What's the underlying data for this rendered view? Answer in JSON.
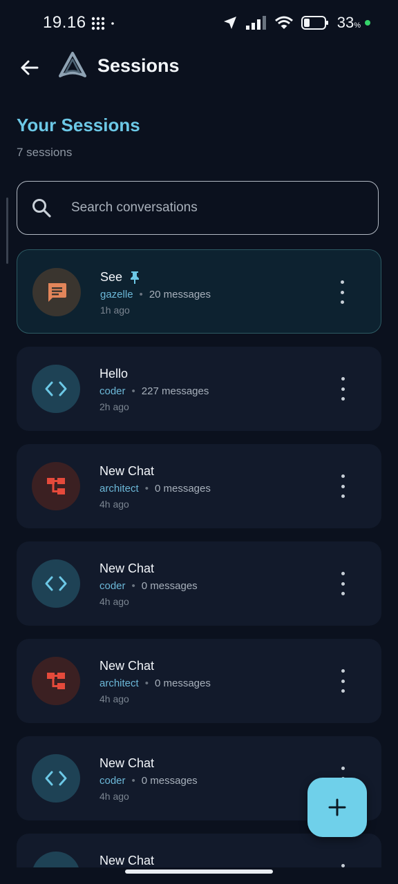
{
  "status_bar": {
    "time": "19.16",
    "battery_percent": "33",
    "battery_unit": "%"
  },
  "header": {
    "title": "Sessions"
  },
  "section": {
    "title": "Your Sessions",
    "count": "7 sessions"
  },
  "search": {
    "placeholder": "Search conversations",
    "value": ""
  },
  "sessions": [
    {
      "title": "See",
      "pinned": true,
      "agent": "gazelle",
      "messages": "20 messages",
      "time": "1h ago",
      "icon": "chat-icon"
    },
    {
      "title": "Hello",
      "pinned": false,
      "agent": "coder",
      "messages": "227 messages",
      "time": "2h ago",
      "icon": "code-icon"
    },
    {
      "title": "New Chat",
      "pinned": false,
      "agent": "architect",
      "messages": "0 messages",
      "time": "4h ago",
      "icon": "hierarchy-icon"
    },
    {
      "title": "New Chat",
      "pinned": false,
      "agent": "coder",
      "messages": "0 messages",
      "time": "4h ago",
      "icon": "code-icon"
    },
    {
      "title": "New Chat",
      "pinned": false,
      "agent": "architect",
      "messages": "0 messages",
      "time": "4h ago",
      "icon": "hierarchy-icon"
    },
    {
      "title": "New Chat",
      "pinned": false,
      "agent": "coder",
      "messages": "0 messages",
      "time": "4h ago",
      "icon": "code-icon"
    },
    {
      "title": "New Chat",
      "pinned": false,
      "agent": "",
      "messages": "",
      "time": "",
      "icon": "code-icon"
    }
  ],
  "colors": {
    "accent": "#6fd0ea",
    "title_accent": "#6cc8e6",
    "background": "#0b111e",
    "card": "#121a2b",
    "pinned_card": "#0d2230"
  }
}
